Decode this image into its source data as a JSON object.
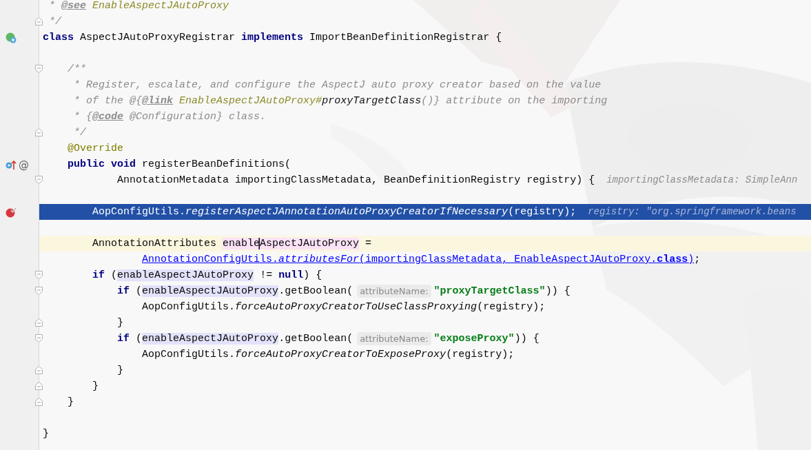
{
  "lines": [
    {
      "segments": [
        {
          "text": " * ",
          "kind": "doc"
        },
        {
          "text": "@see",
          "kind": "doctag"
        },
        {
          "text": " EnableAspectJAutoProxy",
          "kind": "docref"
        }
      ]
    },
    {
      "gutter": [
        {
          "kind": "fold-close"
        }
      ],
      "segments": [
        {
          "text": " */",
          "kind": "doc"
        }
      ]
    },
    {
      "gutter": [
        {
          "kind": "class"
        }
      ],
      "segments": [
        {
          "text": "class",
          "kind": "kw"
        },
        {
          "text": " AspectJAutoProxyRegistrar ",
          "kind": "plain"
        },
        {
          "text": "implements",
          "kind": "kw"
        },
        {
          "text": " ImportBeanDefinitionRegistrar {",
          "kind": "plain"
        }
      ]
    },
    {
      "kind": "blank"
    },
    {
      "gutter": [
        {
          "kind": "fold-open"
        }
      ],
      "segments": [
        {
          "text": "    /**",
          "kind": "doc"
        }
      ]
    },
    {
      "segments": [
        {
          "text": "     * Register, escalate, and configure the AspectJ auto proxy creator based on the value",
          "kind": "doc"
        }
      ]
    },
    {
      "segments": [
        {
          "text": "     * of the @{",
          "kind": "doc"
        },
        {
          "text": "@link",
          "kind": "doctag"
        },
        {
          "text": " EnableAspectJAutoProxy#",
          "kind": "docref"
        },
        {
          "text": "proxyTargetClass",
          "kind": "docmethod"
        },
        {
          "text": "()} attribute on the importing",
          "kind": "doc"
        }
      ]
    },
    {
      "segments": [
        {
          "text": "     * {",
          "kind": "doc"
        },
        {
          "text": "@code",
          "kind": "doctag"
        },
        {
          "text": " @Configuration} class.",
          "kind": "doc"
        }
      ]
    },
    {
      "gutter": [
        {
          "kind": "fold-close"
        }
      ],
      "segments": [
        {
          "text": "     */",
          "kind": "doc"
        }
      ]
    },
    {
      "segments": [
        {
          "text": "    @Override",
          "kind": "ann"
        }
      ]
    },
    {
      "gutter": [
        {
          "kind": "override"
        },
        {
          "kind": "annotation",
          "text": "@"
        }
      ],
      "segments": [
        {
          "text": "    public",
          "kind": "kw"
        },
        {
          "text": " void",
          "kind": "kw"
        },
        {
          "text": " registerBeanDefinitions(",
          "kind": "plain"
        }
      ]
    },
    {
      "gutter": [
        {
          "kind": "fold-open"
        }
      ],
      "segments": [
        {
          "text": "            AnnotationMetadata importingClassMetadata, BeanDefinitionRegistry registry) {",
          "kind": "plain"
        },
        {
          "text": "importingClassMetadata: SimpleAnn",
          "kind": "inlay"
        }
      ]
    },
    {
      "kind": "blank"
    },
    {
      "selected": true,
      "gutter": [
        {
          "kind": "breakpoint"
        }
      ],
      "segments": [
        {
          "text": "        AopConfigUtils.",
          "kind": "plain"
        },
        {
          "text": "registerAspectJAnnotationAutoProxyCreatorIfNecessary",
          "kind": "call"
        },
        {
          "text": "(registry);",
          "kind": "plain"
        },
        {
          "text": "registry: \"org.springframework.beans",
          "kind": "inlay"
        }
      ]
    },
    {
      "kind": "blank"
    },
    {
      "current": true,
      "segments": [
        {
          "text": "        AnnotationAttributes ",
          "kind": "plain"
        },
        {
          "text": "enable",
          "kind": "write",
          "caret": true
        },
        {
          "text": "AspectJAutoProxy",
          "kind": "write"
        },
        {
          "text": " =",
          "kind": "plain"
        }
      ]
    },
    {
      "segments": [
        {
          "text": "                AnnotationConfigUtils.",
          "kind": "link"
        },
        {
          "text": "attributesFor",
          "kind": "linkcall"
        },
        {
          "text": "(importingClassMetadata, EnableAspectJAutoProxy.",
          "kind": "link"
        },
        {
          "text": "class",
          "kind": "linkkw"
        },
        {
          "text": ")",
          "kind": "link"
        },
        {
          "text": ";",
          "kind": "plain"
        }
      ]
    },
    {
      "gutter": [
        {
          "kind": "fold-open"
        }
      ],
      "segments": [
        {
          "text": "        if",
          "kind": "kw"
        },
        {
          "text": " (",
          "kind": "plain"
        },
        {
          "text": "enableAspectJAutoProxy",
          "kind": "usage"
        },
        {
          "text": " != ",
          "kind": "plain"
        },
        {
          "text": "null",
          "kind": "kw"
        },
        {
          "text": ") {",
          "kind": "plain"
        }
      ]
    },
    {
      "gutter": [
        {
          "kind": "fold-open"
        }
      ],
      "segments": [
        {
          "text": "            if",
          "kind": "kw"
        },
        {
          "text": " (",
          "kind": "plain"
        },
        {
          "text": "enableAspectJAutoProxy",
          "kind": "usage"
        },
        {
          "text": ".getBoolean(",
          "kind": "plain"
        },
        {
          "text": "attributeName:",
          "kind": "hint"
        },
        {
          "text": "\"proxyTargetClass\"",
          "kind": "str"
        },
        {
          "text": ")) {",
          "kind": "plain"
        }
      ]
    },
    {
      "segments": [
        {
          "text": "                AopConfigUtils.",
          "kind": "plain"
        },
        {
          "text": "forceAutoProxyCreatorToUseClassProxying",
          "kind": "call"
        },
        {
          "text": "(registry);",
          "kind": "plain"
        }
      ]
    },
    {
      "gutter": [
        {
          "kind": "fold-close"
        }
      ],
      "segments": [
        {
          "text": "            }",
          "kind": "plain"
        }
      ]
    },
    {
      "gutter": [
        {
          "kind": "fold-open"
        }
      ],
      "segments": [
        {
          "text": "            if",
          "kind": "kw"
        },
        {
          "text": " (",
          "kind": "plain"
        },
        {
          "text": "enableAspectJAutoProxy",
          "kind": "usage"
        },
        {
          "text": ".getBoolean(",
          "kind": "plain"
        },
        {
          "text": "attributeName:",
          "kind": "hint"
        },
        {
          "text": "\"exposeProxy\"",
          "kind": "str"
        },
        {
          "text": ")) {",
          "kind": "plain"
        }
      ]
    },
    {
      "segments": [
        {
          "text": "                AopConfigUtils.",
          "kind": "plain"
        },
        {
          "text": "forceAutoProxyCreatorToExposeProxy",
          "kind": "call"
        },
        {
          "text": "(registry);",
          "kind": "plain"
        }
      ]
    },
    {
      "gutter": [
        {
          "kind": "fold-close"
        }
      ],
      "segments": [
        {
          "text": "            }",
          "kind": "plain"
        }
      ]
    },
    {
      "gutter": [
        {
          "kind": "fold-close"
        }
      ],
      "segments": [
        {
          "text": "        }",
          "kind": "plain"
        }
      ]
    },
    {
      "gutter": [
        {
          "kind": "fold-close"
        }
      ],
      "segments": [
        {
          "text": "    }",
          "kind": "plain"
        }
      ]
    },
    {
      "kind": "blank"
    },
    {
      "segments": [
        {
          "text": "}",
          "kind": "plain"
        }
      ]
    },
    {
      "kind": "blank"
    }
  ]
}
